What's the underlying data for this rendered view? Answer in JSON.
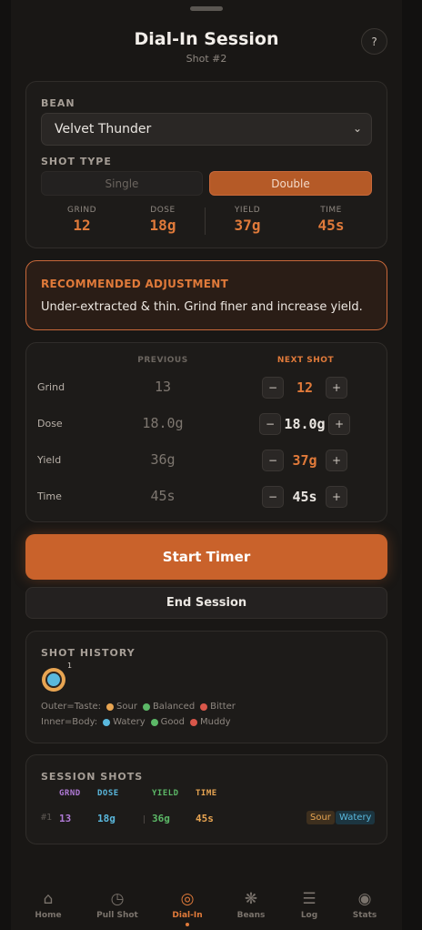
{
  "header": {
    "title": "Dial-In Session",
    "subtitle": "Shot #2",
    "help_label": "?"
  },
  "bean": {
    "label": "BEAN",
    "selected": "Velvet Thunder"
  },
  "shot_type": {
    "label": "SHOT TYPE",
    "options": [
      "Single",
      "Double"
    ],
    "selected": "Double"
  },
  "summary": [
    {
      "key": "GRIND",
      "value": "12"
    },
    {
      "key": "DOSE",
      "value": "18g"
    },
    {
      "key": "YIELD",
      "value": "37g"
    },
    {
      "key": "TIME",
      "value": "45s"
    }
  ],
  "recommendation": {
    "heading": "RECOMMENDED ADJUSTMENT",
    "body": "Under-extracted & thin. Grind finer and increase yield."
  },
  "adjust": {
    "col_previous": "PREVIOUS",
    "col_next": "NEXT SHOT",
    "rows": [
      {
        "label": "Grind",
        "previous": "13",
        "next": "12"
      },
      {
        "label": "Dose",
        "previous": "18.0g",
        "next": "18.0g"
      },
      {
        "label": "Yield",
        "previous": "36g",
        "next": "37g"
      },
      {
        "label": "Time",
        "previous": "45s",
        "next": "45s"
      }
    ],
    "minus": "−",
    "plus": "+"
  },
  "actions": {
    "start_timer": "Start Timer",
    "end_session": "End Session"
  },
  "history": {
    "label": "SHOT HISTORY",
    "marker_number": "1",
    "legend_outer_label": "Outer=Taste:",
    "legend_outer": [
      {
        "name": "Sour",
        "color": "#e8a552"
      },
      {
        "name": "Balanced",
        "color": "#5cb867"
      },
      {
        "name": "Bitter",
        "color": "#d9574a"
      }
    ],
    "legend_inner_label": "Inner=Body:",
    "legend_inner": [
      {
        "name": "Watery",
        "color": "#5ab8dd"
      },
      {
        "name": "Good",
        "color": "#5cb867"
      },
      {
        "name": "Muddy",
        "color": "#d9574a"
      }
    ]
  },
  "session_shots": {
    "label": "SESSION SHOTS",
    "columns": [
      "GRND",
      "DOSE",
      "YIELD",
      "TIME"
    ],
    "rows": [
      {
        "num": "#1",
        "grind": "13",
        "dose": "18g",
        "yield": "36g",
        "time": "45s",
        "taste": "Sour",
        "body": "Watery"
      }
    ]
  },
  "nav": {
    "items": [
      {
        "label": "Home",
        "icon": "⌂"
      },
      {
        "label": "Pull Shot",
        "icon": "◷"
      },
      {
        "label": "Dial-In",
        "icon": "◎"
      },
      {
        "label": "Beans",
        "icon": "❋"
      },
      {
        "label": "Log",
        "icon": "☰"
      },
      {
        "label": "Stats",
        "icon": "◉"
      }
    ],
    "active": "Dial-In"
  },
  "colors": {
    "accent": "#c9622b",
    "accent_text": "#e07a3a",
    "grind": "#b07ad6",
    "dose": "#5ab8dd",
    "yield": "#5cb867",
    "time": "#e8a552"
  }
}
